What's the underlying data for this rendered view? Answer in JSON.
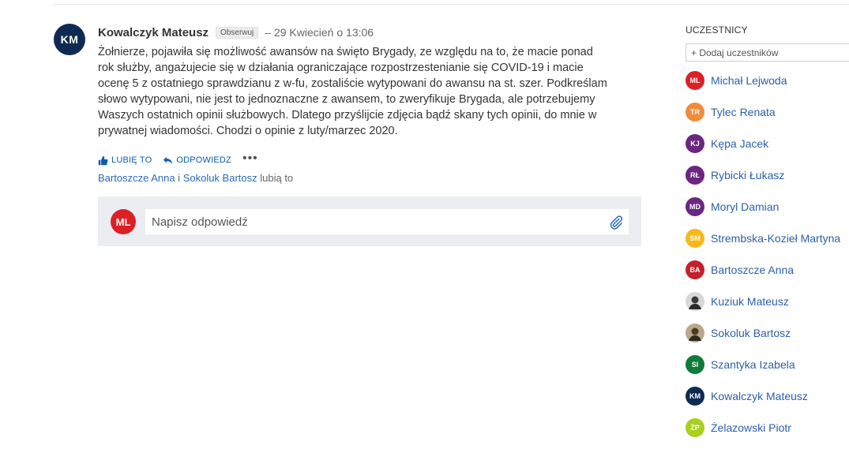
{
  "post": {
    "avatar_initials": "KM",
    "author": "Kowalczyk Mateusz",
    "follow_label": "Obserwuj",
    "date": "– 29 Kwiecień o 13:06",
    "body": "Żołnierze, pojawiła się możliwość awansów na święto Brygady, ze względu na to, że macie ponad rok służby, angażujecie się w działania ograniczające rozpostrzestenianie się COVID-19 i macie ocenę 5 z ostatniego sprawdzianu z w-fu, zostaliście wytypowani do awansu na st. szer. Podkreślam słowo wytypowani, nie jest to jednoznaczne z awansem, to zweryfikuje Brygada, ale potrzebujemy Waszych ostatnich opinii służbowych. Dlatego przyślijcie zdjęcia bądź skany tych opinii, do mnie w prywatnej wiadomości. Chodzi o opinie z luty/marzec 2020.",
    "actions": {
      "like": "LUBIĘ TO",
      "reply": "ODPOWIEDZ",
      "more": "•••"
    },
    "likes": {
      "person1": "Bartoszcze Anna",
      "conjunction": " i ",
      "person2": "Sokoluk Bartosz",
      "suffix": " lubią to"
    }
  },
  "reply": {
    "avatar_initials": "ML",
    "placeholder": "Napisz odpowiedź"
  },
  "participants": {
    "title": "UCZESTNICY",
    "add_label": "+ Dodaj uczestników",
    "list": [
      {
        "initials": "ML",
        "name": "Michał Lejwoda",
        "color": "#dd1f26"
      },
      {
        "initials": "TR",
        "name": "Tylec Renata",
        "color": "#f08c3c"
      },
      {
        "initials": "KJ",
        "name": "Kępa Jacek",
        "color": "#6a2680"
      },
      {
        "initials": "RŁ",
        "name": "Rybicki Łukasz",
        "color": "#6a2680"
      },
      {
        "initials": "MD",
        "name": "Moryl Damian",
        "color": "#6a2680"
      },
      {
        "initials": "SM",
        "name": "Strembska-Kozieł Martyna",
        "color": "#f6b81c"
      },
      {
        "initials": "BA",
        "name": "Bartoszcze Anna",
        "color": "#c4202b"
      },
      {
        "initials": "",
        "name": "Kuziuk Mateusz",
        "color": "#3a3a3a"
      },
      {
        "initials": "",
        "name": "Sokoluk Bartosz",
        "color": "#5a4a2e"
      },
      {
        "initials": "SI",
        "name": "Szantyka Izabela",
        "color": "#0f7a3a"
      },
      {
        "initials": "KM",
        "name": "Kowalczyk Mateusz",
        "color": "#0f2a52"
      },
      {
        "initials": "ŻP",
        "name": "Żelazowski Piotr",
        "color": "#a6d11e"
      }
    ]
  }
}
